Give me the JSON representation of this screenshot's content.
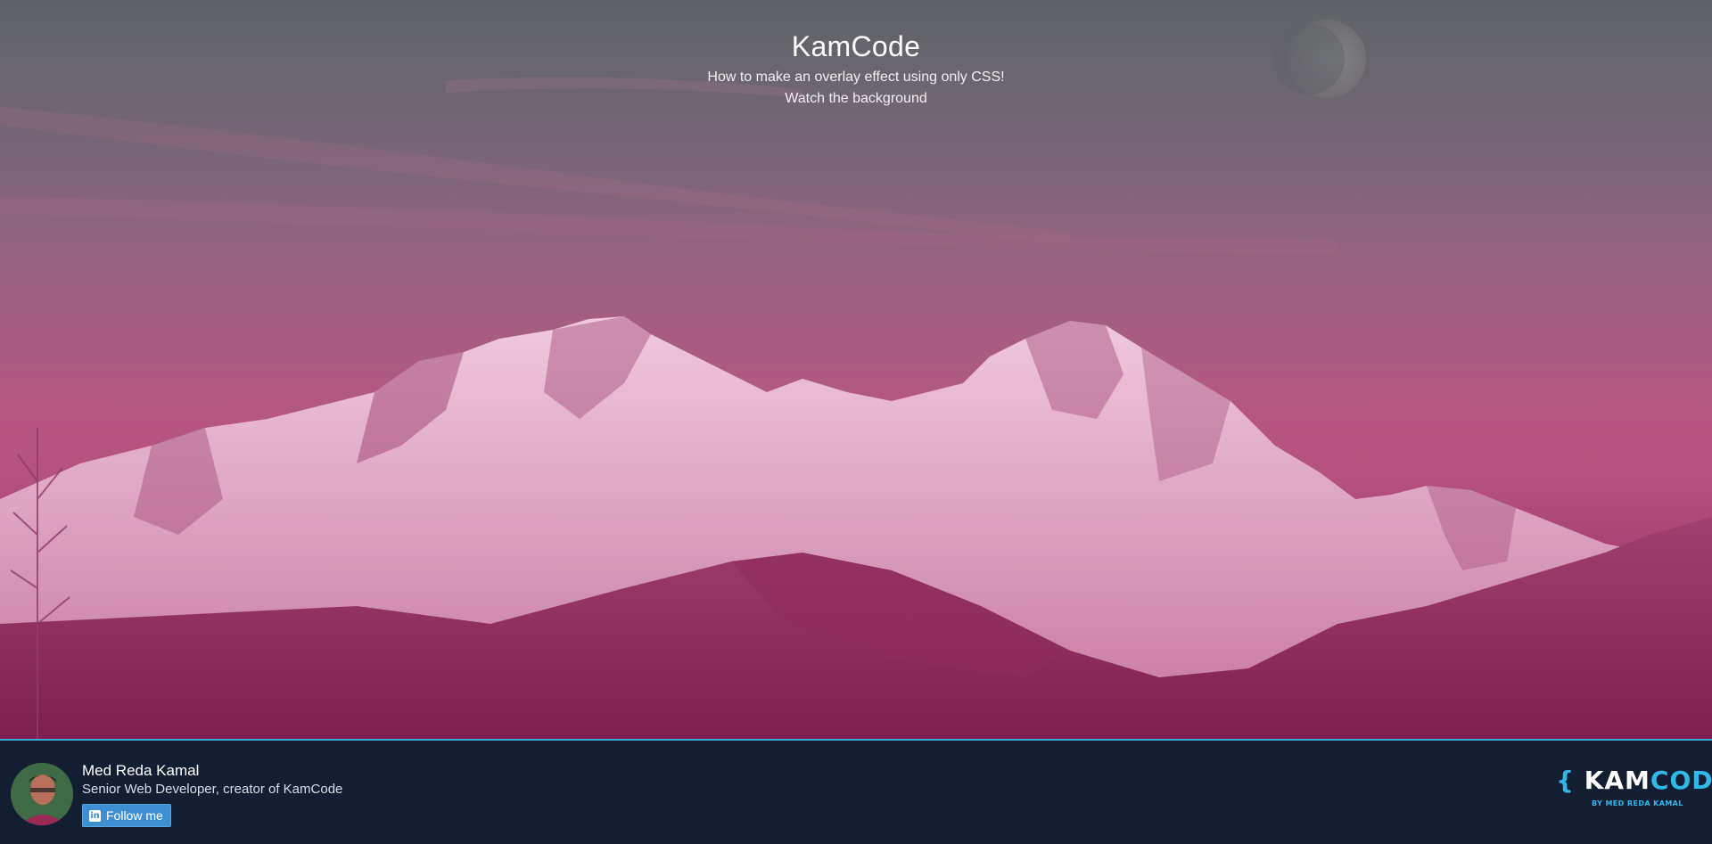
{
  "hero": {
    "title": "KamCode",
    "subtitle_line1": "How to make an overlay effect using only CSS!",
    "subtitle_line2": "Watch the background"
  },
  "footer": {
    "author_name": "Med Reda Kamal",
    "author_role": "Senior Web Developer, creator of KamCode",
    "follow_label": "Follow me",
    "follow_icon": "linkedin-icon",
    "logo": {
      "brace_open": "{",
      "kam": "KAM",
      "code": "CODE",
      "brace_close": "}",
      "tagline": "BY MED REDA KAMAL"
    }
  },
  "colors": {
    "accent": "#2fb8e8",
    "footer_bg": "#141e32",
    "button_bg": "#3d8fd1",
    "overlay_pink": "#b5527e"
  }
}
